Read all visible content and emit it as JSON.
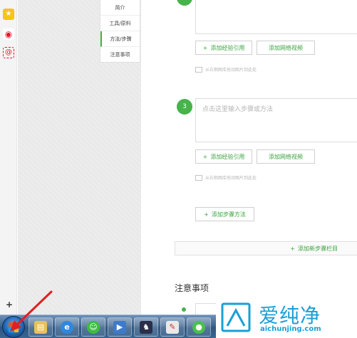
{
  "left_strip": {
    "icons": [
      "star-icon",
      "weibo-icon",
      "at-sign-icon"
    ],
    "plus_label": "+"
  },
  "side_nav": {
    "items": [
      {
        "label": "简介"
      },
      {
        "label": "工具/原料"
      },
      {
        "label": "方法/步骤",
        "active": true
      },
      {
        "label": "注意事项"
      }
    ]
  },
  "steps": [
    {
      "number": "",
      "placeholder": "",
      "add_experience": "添加经验引用",
      "add_video": "添加网络视频",
      "drag_hint": "从右侧图库拖动图片到此处"
    },
    {
      "number": "3",
      "placeholder": "点击这里输入步骤或方法",
      "add_experience": "添加经验引用",
      "add_video": "添加网络视频",
      "drag_hint": "从右侧图库拖动图片到此处"
    }
  ],
  "add_step_method": "添加步骤方法",
  "add_new_section": "添加新步骤栏目",
  "notes": {
    "title": "注意事项"
  },
  "colors": {
    "accent": "#3aa33f",
    "step_circle": "#46b34b",
    "watermark": "#1a9fd6"
  },
  "taskbar": {
    "apps": [
      "windows-explorer-icon",
      "internet-explorer-icon",
      "chat-icon",
      "media-player-icon",
      "game-icon",
      "paint-icon",
      "wechat-icon"
    ]
  },
  "watermark": {
    "brand": "爱纯净",
    "url": "aichunjing.com"
  }
}
